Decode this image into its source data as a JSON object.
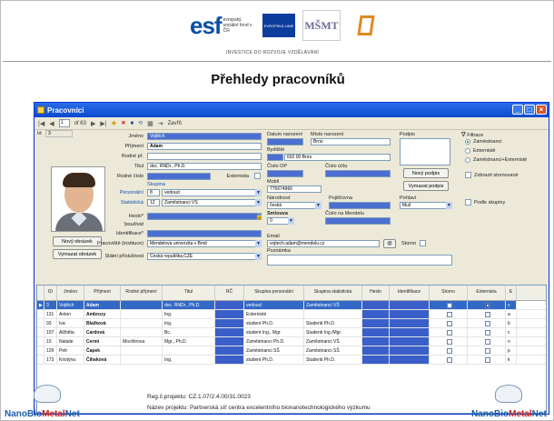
{
  "header": {
    "esf_mark": "esf",
    "esf_sub": "evropský sociální fond v ČR",
    "eu_label": "EVROPSKÁ UNIE",
    "msmt_label": "MŠMT",
    "op_label": "OP Vzdělávání pro konkurenceschopnost",
    "tagline": "INVESTICE DO ROZVOJE VZDĚLÁVÁNÍ",
    "slide_title": "Přehledy pracovníků"
  },
  "window": {
    "title": "Pracovníci",
    "toolbar": {
      "record_index": "1",
      "record_of": "of 63",
      "close_label": "Zavřít"
    },
    "form": {
      "id_label": "Id",
      "id_value": "3",
      "jmeno_label": "Jméno",
      "jmeno_value": "Vojtěch",
      "prijmeni_label": "Příjmení",
      "prijmeni_value": "Adam",
      "rodne_prijmeni_label": "Rodné př.",
      "titul_label": "Titul",
      "titul_value": "doc. RNDr., Ph.D.",
      "rodne_cislo_label": "Rodné číslo",
      "externista_label": "Externista",
      "skupina_label": "Skupina",
      "personalni_label": "Personální",
      "personalni_code": "8",
      "personalni_value": "vedoucí",
      "statisticka_label": "Statistická",
      "statisticka_code": "12",
      "statisticka_value": "Zaměstnanci VŠ",
      "heslo_label": "Heslo*",
      "pouzivat_label": "\"použivat",
      "identifikace_label": "Identifikace*",
      "pracoviste_label": "Pracoviště (instituce)",
      "pracoviste_value": "Mendelova univerzita v Brně",
      "statni_prislusnost_label": "Státní příslušnost",
      "statni_prislusnost_value": "Česká republika,CZE",
      "datum_narozeni_label": "Datum narození",
      "misto_narozeni_label": "Místo narození",
      "misto_narozeni_value": "Brno",
      "bydliste_label": "Bydliště",
      "bydliste_value": "602 00 Brno",
      "cislo_op_label": "Číslo OP",
      "cislo_uctu_label": "Číslo účtu",
      "mobil_label": "Mobil",
      "mobil_value": "775674966",
      "narodnost_label": "Národnost",
      "narodnost_value": "česká",
      "pojistovna_label": "Pojišťovna",
      "smlouva_label": "Smlouva",
      "smlouva_value": "0",
      "cislo_mendelu_label": "Číslo na Mendelu",
      "email_label": "Email",
      "email_value": "vojtech.adam@mendelu.cz",
      "poznamka_label": "Poznámka",
      "storno_label": "Storno",
      "podpis_label": "Podpis",
      "novy_podpis_label": "Nový podpis",
      "vymazat_podpis_label": "Vymazat podpis",
      "pohlavi_label": "Pohlaví",
      "pohlavi_value": "Muž",
      "novy_obrazek_label": "Nový obrázek",
      "vymazat_obrazek_label": "Vymazat obrázek",
      "email_btn_label": "@"
    },
    "filter": {
      "heading": "Filtrace",
      "options": [
        "Zaměstnanci",
        "Externisté",
        "Zaměstnanci+Externisté"
      ],
      "selected_index": 0,
      "zobrazit_stornovane": "Zobrazit stornované",
      "podle_skupiny": "Podle skupiny"
    },
    "grid": {
      "columns": [
        "ID",
        "Jméno",
        "Příjmení",
        "Rodné příjmení",
        "Titul",
        "RČ",
        "Skupina personální",
        "Skupina statistická",
        "Heslo",
        "Identifikace",
        "Storno",
        "Externista",
        "E"
      ],
      "rows": [
        {
          "id": "3",
          "jmeno": "Vojtěch",
          "prijmeni": "Adam",
          "rodne": "",
          "titul": "doc. RNDr., Ph.D.",
          "sk_pers": "vedoucí",
          "sk_stat": "Zaměstnanci VŠ",
          "e": "v",
          "selected": true
        },
        {
          "id": "131",
          "jmeno": "Anton",
          "prijmeni": "Ambrozy",
          "rodne": "",
          "titul": "Ing.",
          "sk_pers": "Externisté",
          "sk_stat": "",
          "e": "a",
          "selected": false
        },
        {
          "id": "93",
          "jmeno": "Iva",
          "prijmeni": "Blažková",
          "rodne": "",
          "titul": "Ing.",
          "sk_pers": "student Ph.D.",
          "sk_stat": "Studenti Ph.D.",
          "e": "b",
          "selected": false
        },
        {
          "id": "107",
          "jmeno": "Alžběta",
          "prijmeni": "Cardová",
          "rodne": "",
          "titul": "Bc.",
          "sk_pers": "student Ing., Mgr.",
          "sk_stat": "Studenti Ing./Mgr.",
          "e": "c",
          "selected": false
        },
        {
          "id": "10",
          "jmeno": "Natalie",
          "prijmeni": "Cermi",
          "rodne": "Mochlirova",
          "titul": "Mgr., Ph.D.",
          "sk_pers": "Zaměstnanci Ph.D.",
          "sk_stat": "Zaměstnanci VŠ",
          "e": "n",
          "selected": false
        },
        {
          "id": "129",
          "jmeno": "Petr",
          "prijmeni": "Čapek",
          "rodne": "",
          "titul": "",
          "sk_pers": "Zaměstnanci SŠ",
          "sk_stat": "Zaměstnanci SŠ",
          "e": "p",
          "selected": false
        },
        {
          "id": "173",
          "jmeno": "Kristýna",
          "prijmeni": "Čihaková",
          "rodne": "",
          "titul": "Ing.",
          "sk_pers": "student Ph.D.",
          "sk_stat": "Studenti Ph.D.",
          "e": "k",
          "selected": false
        }
      ]
    }
  },
  "footer": {
    "left_logo": "NanoBioMetalNet",
    "right_logo": "NanoBioMetalNet",
    "reg_text": "Reg.č.projektu: CZ.1.07/2.4.00/31.0023",
    "nazev_text": "Název projektu: Partnerská síť centra excelentního bionanotechnologického výzkumu"
  }
}
